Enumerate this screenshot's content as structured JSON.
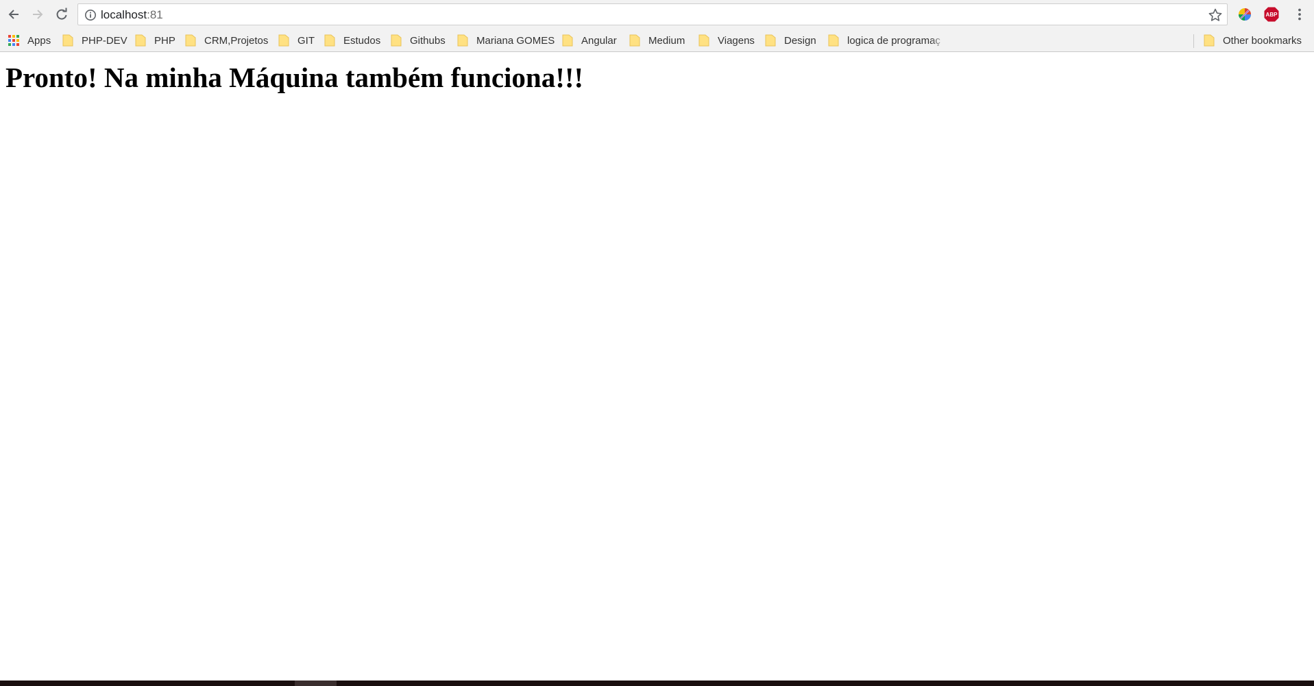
{
  "browser": {
    "address_bar": {
      "host": "localhost",
      "port": ":81"
    },
    "extensions": [
      {
        "name": "Rainbow extension",
        "icon": "rainbow-extension-icon"
      },
      {
        "name": "Adblock Plus",
        "icon": "adblock-plus-icon",
        "badge_text": "ABP",
        "color": "#c70d2c"
      }
    ],
    "bookmarks": {
      "apps_label": "Apps",
      "items": [
        {
          "label": "PHP-DEV"
        },
        {
          "label": "PHP"
        },
        {
          "label": "CRM,Projetos"
        },
        {
          "label": "GIT"
        },
        {
          "label": "Estudos"
        },
        {
          "label": "Githubs"
        },
        {
          "label": "Mariana GOMES"
        },
        {
          "label": "Angular"
        },
        {
          "label": "Medium"
        },
        {
          "label": "Viagens"
        },
        {
          "label": "Design"
        },
        {
          "label": "logica de programaç"
        }
      ],
      "other_label": "Other bookmarks"
    }
  },
  "page": {
    "heading": "Pronto! Na minha Máquina também funciona!!!"
  }
}
